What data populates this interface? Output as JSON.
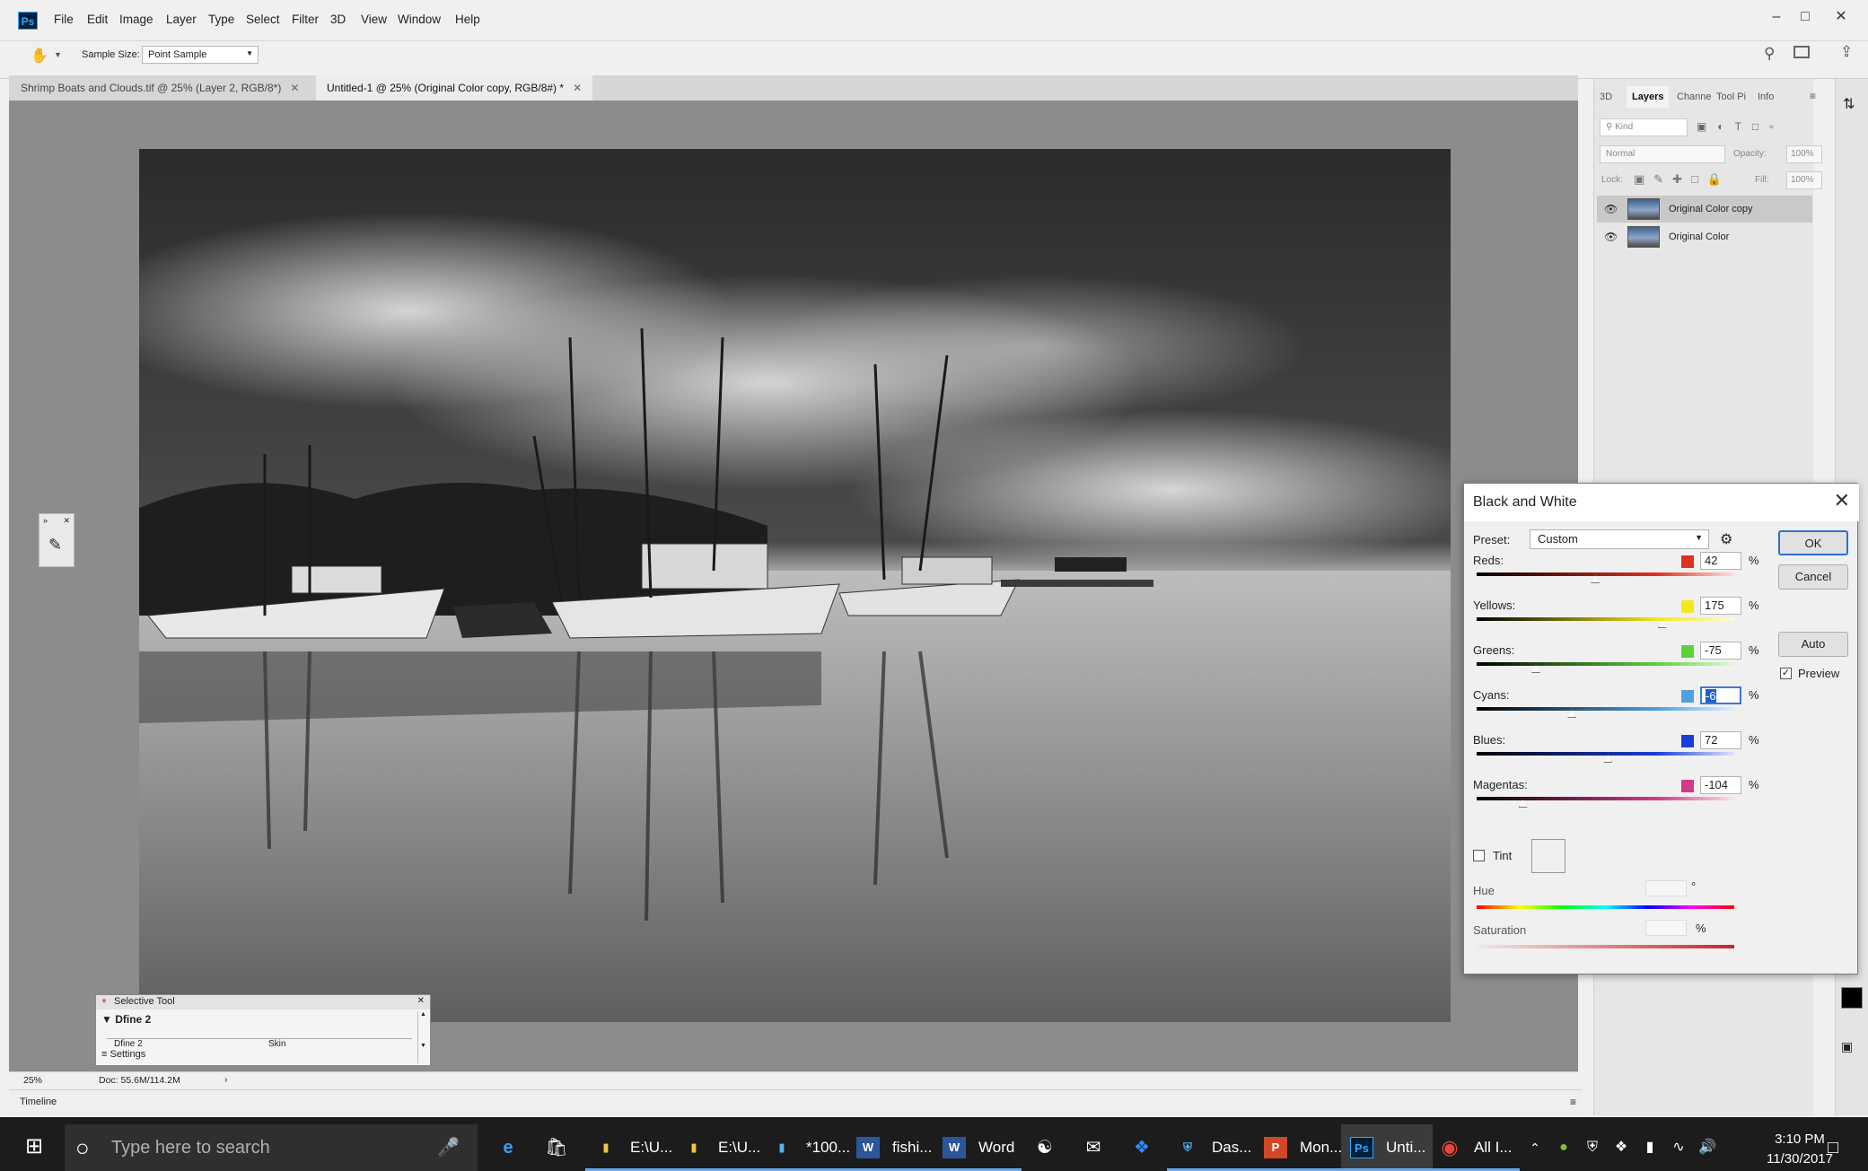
{
  "menubar": {
    "items": [
      "File",
      "Edit",
      "Image",
      "Layer",
      "Type",
      "Select",
      "Filter",
      "3D",
      "View",
      "Window",
      "Help"
    ],
    "app_icon": "Ps"
  },
  "options": {
    "sample_size_label": "Sample Size:",
    "sample_size_value": "Point Sample"
  },
  "tabs": [
    {
      "label": "Shrimp Boats and Clouds.tif @ 25% (Layer 2, RGB/8*)",
      "active": false
    },
    {
      "label": "Untitled-1 @ 25% (Original Color copy, RGB/8#) *",
      "active": true
    }
  ],
  "status": {
    "zoom": "25%",
    "doc": "Doc: 55.6M/114.2M",
    "timeline": "Timeline"
  },
  "panel": {
    "tabs": [
      "3D",
      "Layers",
      "Channe",
      "Tool Pi",
      "Info"
    ],
    "kind_placeholder": "Kind",
    "blend_mode": "Normal",
    "opacity_label": "Opacity:",
    "opacity_value": "100%",
    "lock_label": "Lock:",
    "fill_label": "Fill:",
    "fill_value": "100%",
    "layers": [
      {
        "name": "Original Color copy",
        "selected": true
      },
      {
        "name": "Original Color",
        "selected": false
      }
    ]
  },
  "bw_dialog": {
    "title": "Black and White",
    "preset_label": "Preset:",
    "preset_value": "Custom",
    "ok": "OK",
    "cancel": "Cancel",
    "auto": "Auto",
    "preview": "Preview",
    "channels": [
      {
        "label": "Reds:",
        "value": "42",
        "color": "#e0311f",
        "pos": 0.46
      },
      {
        "label": "Yellows:",
        "value": "175",
        "color": "#f4e81a",
        "pos": 0.72
      },
      {
        "label": "Greens:",
        "value": "-75",
        "color": "#5bd13b",
        "pos": 0.23
      },
      {
        "label": "Cyans:",
        "value": "-6",
        "color": "#4ea0e0",
        "pos": 0.37
      },
      {
        "label": "Blues:",
        "value": "72",
        "color": "#1a3fd8",
        "pos": 0.51
      },
      {
        "label": "Magentas:",
        "value": "-104",
        "color": "#d23a8a",
        "pos": 0.18
      }
    ],
    "tint_label": "Tint",
    "hue_label": "Hue",
    "hue_unit": "°",
    "saturation_label": "Saturation",
    "percent": "%"
  },
  "selective_tool": {
    "title": "Selective Tool",
    "group": "Dfine 2",
    "row_left": "Dfine 2",
    "row_right": "Skin",
    "settings": "Settings"
  },
  "taskbar": {
    "search_placeholder": "Type here to search",
    "apps": [
      {
        "label": "E:\\U...",
        "icon": "folder-icon"
      },
      {
        "label": "E:\\U...",
        "icon": "folder-icon"
      },
      {
        "label": "*100...",
        "icon": "app-icon"
      },
      {
        "label": "fishi...",
        "icon": "word-icon"
      },
      {
        "label": "Word",
        "icon": "word-icon"
      },
      {
        "label": "Das...",
        "icon": "shield-icon"
      },
      {
        "label": "Mon...",
        "icon": "powerpoint-icon"
      },
      {
        "label": "Unti...",
        "icon": "photoshop-icon"
      },
      {
        "label": "All I...",
        "icon": "chrome-icon"
      }
    ],
    "time": "3:10 PM",
    "date": "11/30/2017"
  }
}
